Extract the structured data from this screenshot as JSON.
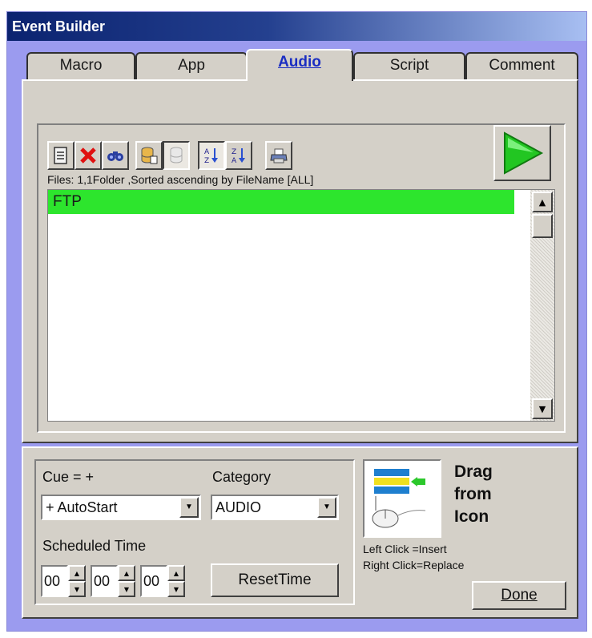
{
  "window": {
    "title": "Event Builder"
  },
  "tabs": [
    {
      "label": "Macro",
      "active": false
    },
    {
      "label": "App",
      "active": false
    },
    {
      "label": "Audio",
      "active": true
    },
    {
      "label": "Script",
      "active": false
    },
    {
      "label": "Comment",
      "active": false
    }
  ],
  "toolbar": {
    "buttons": [
      {
        "icon": "new-list-icon"
      },
      {
        "icon": "delete-icon"
      },
      {
        "icon": "find-icon"
      },
      {
        "icon": "database-edit-icon"
      },
      {
        "icon": "database-icon"
      },
      {
        "icon": "sort-ascending-icon"
      },
      {
        "icon": "sort-descending-icon"
      },
      {
        "icon": "print-icon"
      }
    ],
    "play_icon": "play-icon"
  },
  "files": {
    "info": "Files: 1,1Folder ,Sorted ascending by FileName [ALL]",
    "items": [
      {
        "name": "FTP",
        "selected": true
      }
    ]
  },
  "settings": {
    "cue_label": "Cue = +",
    "cue_value": "+ AutoStart",
    "category_label": "Category",
    "category_value": "AUDIO",
    "scheduled_label": "Scheduled Time",
    "hours": "00",
    "minutes": "00",
    "seconds": "00",
    "reset_label": "ResetTime"
  },
  "drag": {
    "line1": "Drag",
    "line2": "from",
    "line3": "Icon",
    "left_hint": "Left Click  =Insert",
    "right_hint": "Right Click=Replace"
  },
  "done_label": "Done",
  "colors": {
    "selected_row": "#2de52d",
    "title_start": "#0b2370",
    "window_bg": "#9b9bef"
  }
}
